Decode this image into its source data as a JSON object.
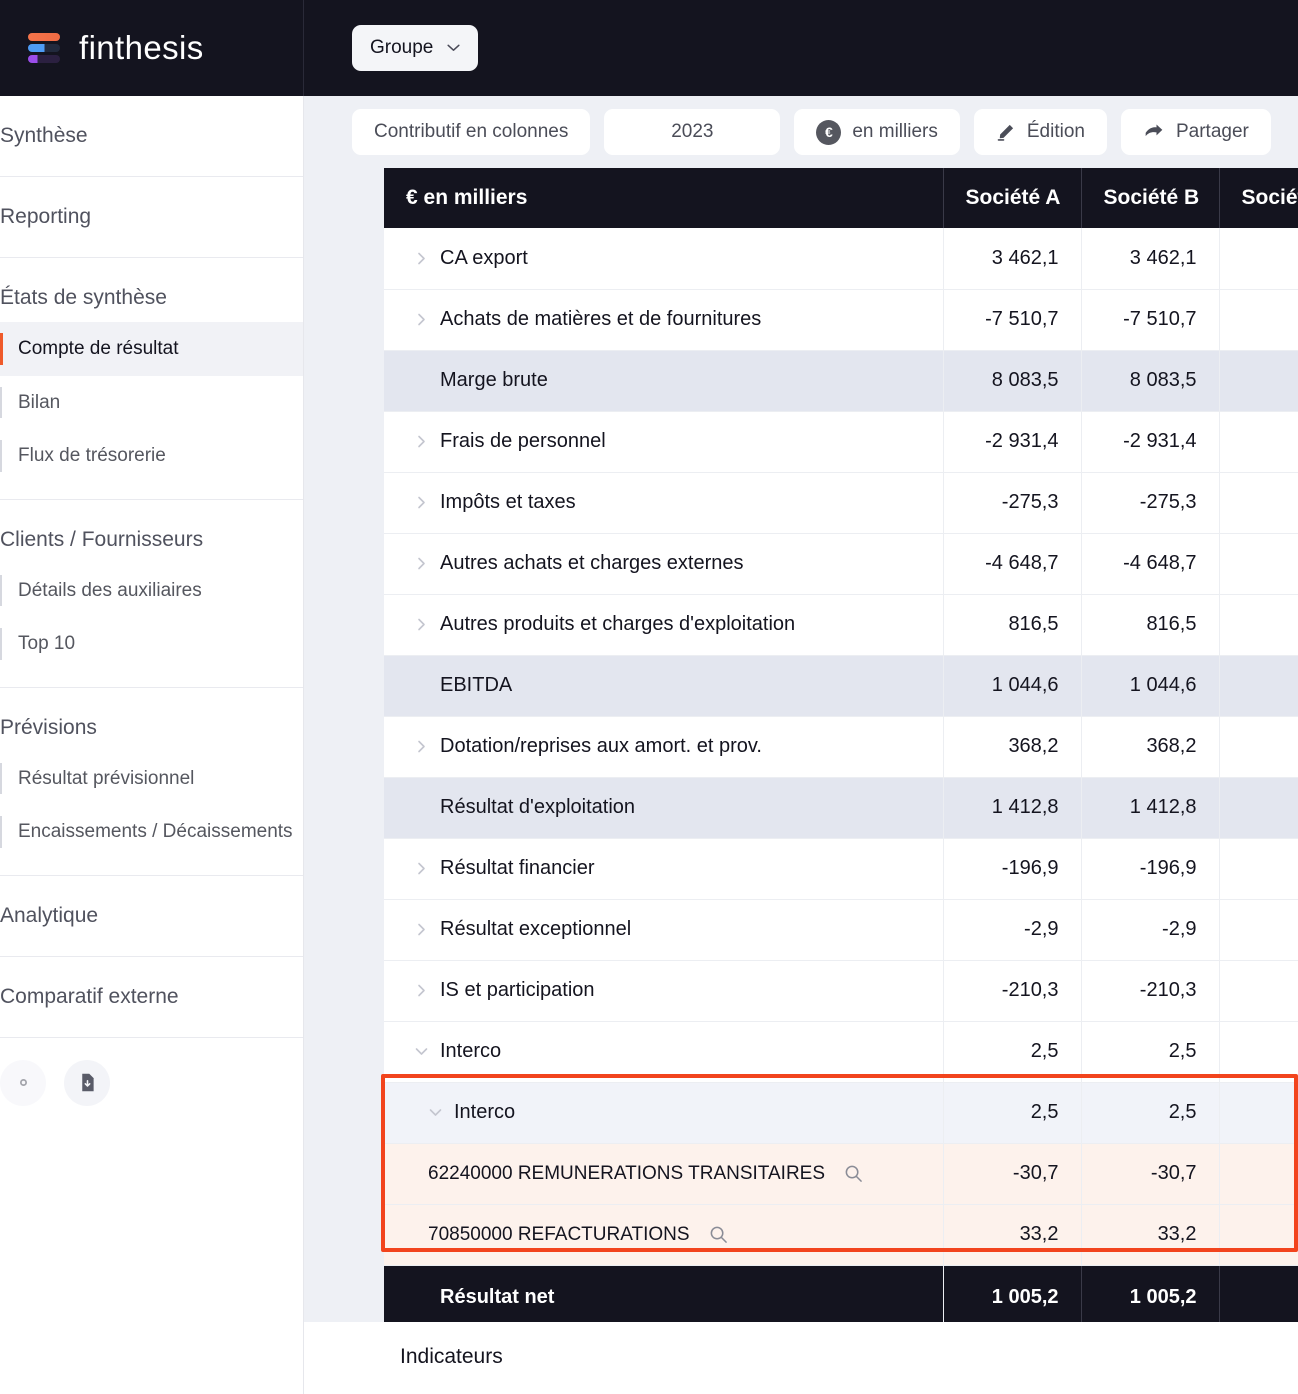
{
  "brand": {
    "name": "finthesis",
    "logo_icon": "finthesis-logo-icon"
  },
  "topbar": {
    "scope_selector": {
      "label": "Groupe",
      "icon": "chevron-down-icon"
    }
  },
  "sidebar": {
    "groups": [
      {
        "title": "Synthèse",
        "items": []
      },
      {
        "title": "Reporting",
        "items": []
      },
      {
        "title": "États de synthèse",
        "items": [
          {
            "label": "Compte de résultat",
            "active": true
          },
          {
            "label": "Bilan",
            "active": false
          },
          {
            "label": "Flux de trésorerie",
            "active": false
          }
        ]
      },
      {
        "title": "Clients / Fournisseurs",
        "items": [
          {
            "label": "Détails des auxiliaires",
            "active": false
          },
          {
            "label": "Top 10",
            "active": false
          }
        ]
      },
      {
        "title": "Prévisions",
        "items": [
          {
            "label": "Résultat prévisionnel",
            "active": false
          },
          {
            "label": "Encaissements / Décaissements",
            "active": false
          }
        ]
      },
      {
        "title": "Analytique",
        "items": []
      },
      {
        "title": "Comparatif externe",
        "items": []
      }
    ],
    "footer_buttons": [
      {
        "icon": "file-download-icon",
        "label": ""
      }
    ],
    "active_accent_color": "#ef5a2a"
  },
  "toolbar": {
    "buttons": [
      {
        "label": "Contributif en colonnes",
        "icon": ""
      },
      {
        "label": "2023",
        "icon": ""
      },
      {
        "label": "en milliers",
        "icon": "euro-icon"
      },
      {
        "label": "Édition",
        "icon": "pencil-icon"
      },
      {
        "label": "Partager",
        "icon": "share-arrow-icon"
      }
    ]
  },
  "table": {
    "columns": [
      "€ en milliers",
      "Société A",
      "Société B",
      "Société"
    ],
    "rows": [
      {
        "label": "CA export",
        "type": "item",
        "expand": "chevron-right-icon",
        "values": [
          "3 462,1",
          "3 462,1",
          ""
        ]
      },
      {
        "label": "Achats de matières et de fournitures",
        "type": "item",
        "expand": "chevron-right-icon",
        "values": [
          "-7 510,7",
          "-7 510,7",
          ""
        ]
      },
      {
        "label": "Marge brute",
        "type": "subtotal",
        "expand": "",
        "values": [
          "8 083,5",
          "8 083,5",
          ""
        ]
      },
      {
        "label": "Frais de personnel",
        "type": "item",
        "expand": "chevron-right-icon",
        "values": [
          "-2 931,4",
          "-2 931,4",
          ""
        ]
      },
      {
        "label": "Impôts et taxes",
        "type": "item",
        "expand": "chevron-right-icon",
        "values": [
          "-275,3",
          "-275,3",
          ""
        ]
      },
      {
        "label": "Autres achats et charges externes",
        "type": "item",
        "expand": "chevron-right-icon",
        "values": [
          "-4 648,7",
          "-4 648,7",
          ""
        ]
      },
      {
        "label": "Autres produits et charges d'exploitation",
        "type": "item",
        "expand": "chevron-right-icon",
        "values": [
          "816,5",
          "816,5",
          ""
        ]
      },
      {
        "label": "EBITDA",
        "type": "subtotal",
        "expand": "",
        "values": [
          "1 044,6",
          "1 044,6",
          ""
        ]
      },
      {
        "label": "Dotation/reprises aux amort. et prov.",
        "type": "item",
        "expand": "chevron-right-icon",
        "values": [
          "368,2",
          "368,2",
          ""
        ]
      },
      {
        "label": "Résultat d'exploitation",
        "type": "subtotal",
        "expand": "",
        "values": [
          "1 412,8",
          "1 412,8",
          ""
        ]
      },
      {
        "label": "Résultat financier",
        "type": "item",
        "expand": "chevron-right-icon",
        "values": [
          "-196,9",
          "-196,9",
          ""
        ]
      },
      {
        "label": "Résultat exceptionnel",
        "type": "item",
        "expand": "chevron-right-icon",
        "values": [
          "-2,9",
          "-2,9",
          ""
        ]
      },
      {
        "label": "IS et participation",
        "type": "item",
        "expand": "chevron-right-icon",
        "values": [
          "-210,3",
          "-210,3",
          ""
        ]
      },
      {
        "label": "Interco",
        "type": "item",
        "expand": "chevron-down-icon",
        "values": [
          "2,5",
          "2,5",
          ""
        ]
      },
      {
        "label": "Interco",
        "type": "lvl2",
        "expand": "chevron-down-icon",
        "values": [
          "2,5",
          "2,5",
          ""
        ]
      },
      {
        "label": "62240000 REMUNERATIONS TRANSITAIRES",
        "type": "leaf",
        "expand": "",
        "search": "search-icon",
        "values": [
          "-30,7",
          "-30,7",
          ""
        ]
      },
      {
        "label": "70850000 REFACTURATIONS",
        "type": "leaf",
        "expand": "",
        "search": "search-icon",
        "values": [
          "33,2",
          "33,2",
          ""
        ]
      },
      {
        "label": "Résultat net",
        "type": "total",
        "expand": "",
        "values": [
          "1 005,2",
          "1 005,2",
          ""
        ]
      }
    ]
  },
  "highlight": {
    "color": "#f2441d",
    "rows": [
      "Interco",
      "62240000 REMUNERATIONS TRANSITAIRES",
      "70850000 REFACTURATIONS"
    ]
  },
  "footer": {
    "section_label": "Indicateurs"
  }
}
